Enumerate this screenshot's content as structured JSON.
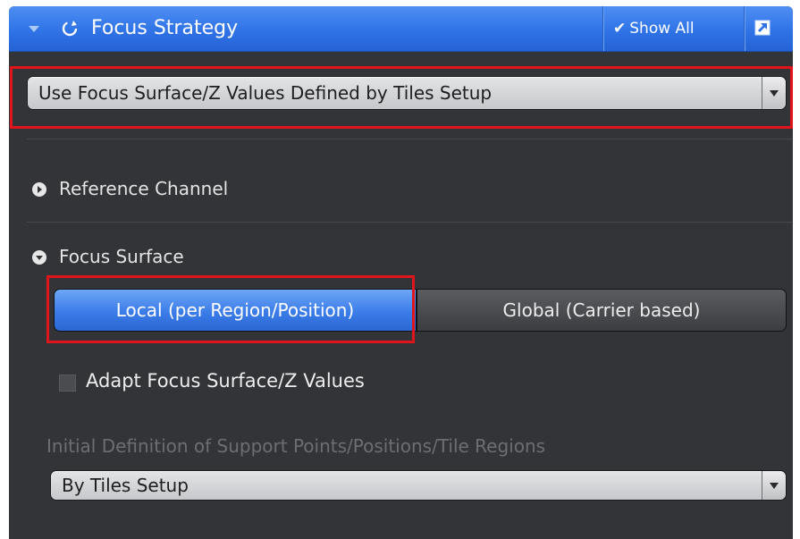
{
  "header": {
    "title": "Focus Strategy",
    "show_all_check": "✔",
    "show_all_label": "Show All",
    "icons": [
      "chevron-down-icon",
      "refresh-icon",
      "checkmark-icon",
      "popout-icon"
    ]
  },
  "strategy_dropdown": {
    "selected": "Use Focus Surface/Z Values Defined by Tiles Setup"
  },
  "reference_channel": {
    "label": "Reference Channel",
    "expanded": false
  },
  "focus_surface": {
    "label": "Focus Surface",
    "expanded": true,
    "options": [
      {
        "label": "Local (per Region/Position)",
        "selected": true
      },
      {
        "label": "Global (Carrier based)",
        "selected": false
      }
    ],
    "adapt_checkbox": {
      "label": "Adapt Focus Surface/Z Values",
      "checked": false
    },
    "initial_definition": {
      "label": "Initial Definition of Support Points/Positions/Tile Regions",
      "selected": "By Tiles Setup"
    }
  },
  "colors": {
    "panel_bg": "#333437",
    "header_blue": "#2f73e6",
    "selected_segment": "#3b7ce8",
    "highlight_red": "#e0151b"
  }
}
